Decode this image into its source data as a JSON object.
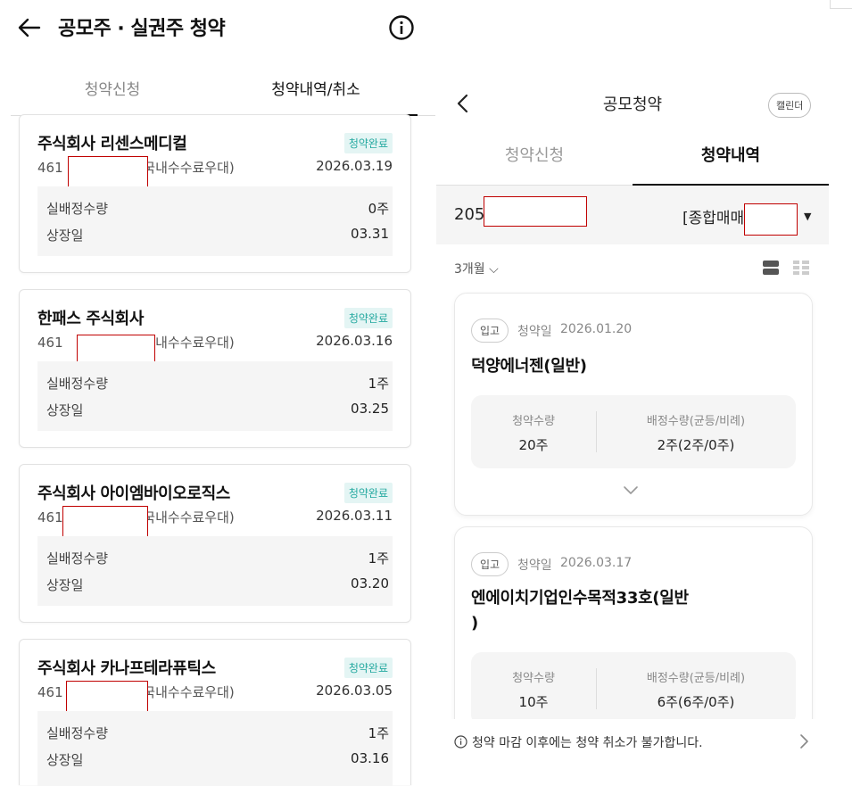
{
  "left": {
    "title": "공모주 · 실권주 청약",
    "tabs": [
      "청약신청",
      "청약내역/취소"
    ],
    "cards": [
      {
        "name": "주식회사 리센스메디컬",
        "badge": "청약완료",
        "acct_prefix": "461",
        "acct_suffix": "탁(국내수수료우대)",
        "date": "2026.03.19",
        "qty_label": "실배정수량",
        "qty": "0주",
        "list_label": "상장일",
        "list_date": "03.31"
      },
      {
        "name": "한패스 주식회사",
        "badge": "청약완료",
        "acct_prefix": "461",
        "acct_suffix": "탁(국내수수료우대)",
        "date": "2026.03.16",
        "qty_label": "실배정수량",
        "qty": "1주",
        "list_label": "상장일",
        "list_date": "03.25"
      },
      {
        "name": "주식회사 아이엠바이오로직스",
        "badge": "청약완료",
        "acct_prefix": "461",
        "acct_suffix": "탁(국내수수료우대)",
        "date": "2026.03.11",
        "qty_label": "실배정수량",
        "qty": "1주",
        "list_label": "상장일",
        "list_date": "03.20"
      },
      {
        "name": "주식회사 카나프테라퓨틱스",
        "badge": "청약완료",
        "acct_prefix": "461",
        "acct_suffix": "탁(국내수수료우대)",
        "date": "2026.03.05",
        "qty_label": "실배정수량",
        "qty": "1주",
        "list_label": "상장일",
        "list_date": "03.16"
      }
    ]
  },
  "right": {
    "title": "공모청약",
    "calendar_label": "캘린더",
    "tabs": [
      "청약신청",
      "청약내역"
    ],
    "account_prefix": "205",
    "account_type": "[종합매매",
    "period": "3개월 ⌵",
    "cards": [
      {
        "pill": "입고",
        "sub_label": "청약일",
        "date": "2026.01.20",
        "title_line1": "덕양에너젠(일반)",
        "title_line2": "",
        "qty_label": "청약수량",
        "qty": "20주",
        "alloc_label": "배정수량(균등/비례)",
        "alloc": "2주(2주/0주)"
      },
      {
        "pill": "입고",
        "sub_label": "청약일",
        "date": "2026.03.17",
        "title_line1": "엔에이치기업인수목적33호(일반",
        "title_line2": ")",
        "qty_label": "청약수량",
        "qty": "10주",
        "alloc_label": "배정수량(균등/비례)",
        "alloc": "6주(6주/0주)"
      }
    ],
    "notice": "청약 마감 이후에는 청약 취소가 불가합니다."
  },
  "colors": {
    "badge_text": "#25a9a0",
    "badge_bg": "#e4f5f4",
    "redaction": "#c00000"
  }
}
